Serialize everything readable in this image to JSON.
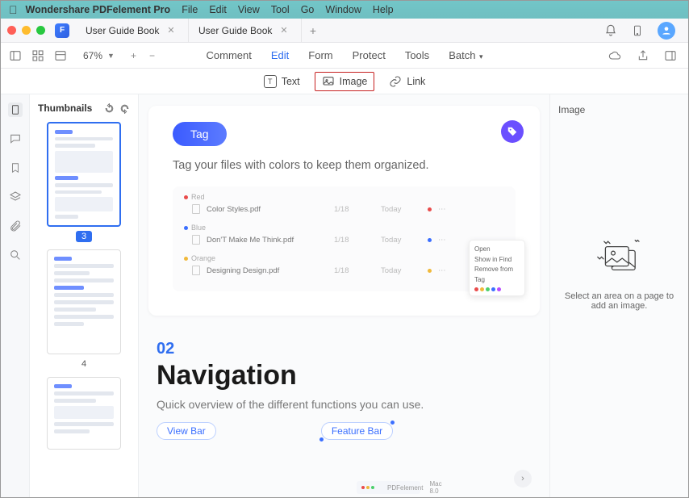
{
  "menubar": {
    "app_name": "Wondershare PDFelement Pro",
    "items": [
      "File",
      "Edit",
      "View",
      "Tool",
      "Go",
      "Window",
      "Help"
    ]
  },
  "tabs": {
    "items": [
      {
        "title": "User Guide Book"
      },
      {
        "title": "User Guide Book"
      }
    ]
  },
  "toolbar": {
    "zoom": "67%",
    "main_tabs": [
      "Comment",
      "Edit",
      "Form",
      "Protect",
      "Tools",
      "Batch"
    ],
    "active_main_tab": "Edit",
    "sub_items": [
      "Text",
      "Image",
      "Link"
    ],
    "active_sub_item": "Image"
  },
  "thumbnails": {
    "title": "Thumbnails",
    "pages": [
      {
        "number": "3",
        "selected": true
      },
      {
        "number": "4",
        "selected": false
      },
      {
        "number": "",
        "selected": false
      }
    ]
  },
  "page_content": {
    "tag_section": {
      "pill": "Tag",
      "desc": "Tag your files with colors to keep them organized.",
      "groups": [
        {
          "color": "red",
          "label": "Red",
          "rows": [
            {
              "name": "Color Styles.pdf",
              "size": "1/18",
              "date": "Today",
              "dot": "#e94b4b"
            }
          ]
        },
        {
          "color": "blue",
          "label": "Blue",
          "rows": [
            {
              "name": "Don'T Make Me Think.pdf",
              "size": "1/18",
              "date": "Today",
              "dot": "#3b6fff"
            }
          ]
        },
        {
          "color": "yellow",
          "label": "Orange",
          "rows": [
            {
              "name": "Designing Design.pdf",
              "size": "1/18",
              "date": "Today",
              "dot": "#f0b93b"
            }
          ]
        }
      ],
      "context_menu": [
        "Open",
        "Show in Find",
        "Remove from",
        "Tag"
      ]
    },
    "nav_section": {
      "num": "02",
      "title": "Navigation",
      "subtitle": "Quick overview of the different functions you can use.",
      "chips": [
        "View Bar",
        "Feature Bar"
      ],
      "minibar_app": "PDFelement",
      "minibar_label": "Mac 8.0"
    }
  },
  "right_panel": {
    "title": "Image",
    "hint": "Select an area on a page to add an image."
  }
}
